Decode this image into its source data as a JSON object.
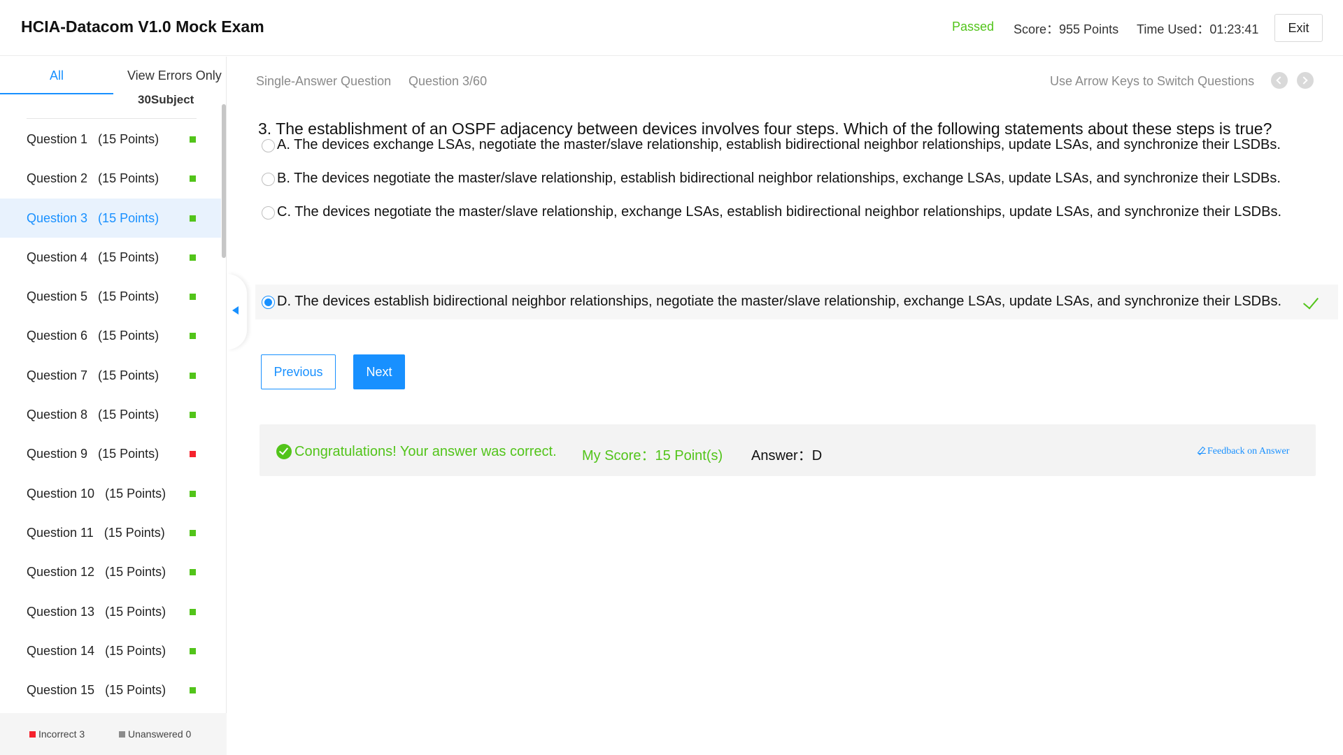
{
  "header": {
    "title": "HCIA-Datacom V1.0 Mock Exam",
    "status": "Passed",
    "score": "Score：955 Points",
    "time_used": "Time Used：01:23:41",
    "exit_label": "Exit",
    "status_color": "#52c41a"
  },
  "sidebar": {
    "tabs": {
      "all": "All",
      "errors_only": "View Errors Only"
    },
    "subject_count": "30Subject",
    "questions": [
      {
        "label": "Question 1   (15 Points)",
        "status": "correct"
      },
      {
        "label": "Question 2   (15 Points)",
        "status": "correct"
      },
      {
        "label": "Question 3   (15 Points)",
        "status": "correct",
        "active": true
      },
      {
        "label": "Question 4   (15 Points)",
        "status": "correct"
      },
      {
        "label": "Question 5   (15 Points)",
        "status": "correct"
      },
      {
        "label": "Question 6   (15 Points)",
        "status": "correct"
      },
      {
        "label": "Question 7   (15 Points)",
        "status": "correct"
      },
      {
        "label": "Question 8   (15 Points)",
        "status": "correct"
      },
      {
        "label": "Question 9   (15 Points)",
        "status": "incorrect"
      },
      {
        "label": "Question 10   (15 Points)",
        "status": "correct"
      },
      {
        "label": "Question 11   (15 Points)",
        "status": "correct"
      },
      {
        "label": "Question 12   (15 Points)",
        "status": "correct"
      },
      {
        "label": "Question 13   (15 Points)",
        "status": "correct"
      },
      {
        "label": "Question 14   (15 Points)",
        "status": "correct"
      },
      {
        "label": "Question 15   (15 Points)",
        "status": "correct"
      }
    ],
    "legend": {
      "incorrect": "Incorrect 3",
      "unanswered": "Unanswered 0"
    },
    "colors": {
      "correct": "#52c41a",
      "incorrect": "#f5222d",
      "unanswered": "#8c8c8c"
    }
  },
  "main": {
    "question_type": "Single-Answer Question",
    "question_number": "Question 3/60",
    "nav_hint": "Use Arrow Keys to Switch Questions",
    "question_text": "3. The establishment of an OSPF adjacency between devices involves four steps. Which of the following statements about these steps is true?",
    "options": [
      {
        "text": "A. The devices exchange LSAs, negotiate the master/slave relationship, establish bidirectional neighbor relationships, update LSAs, and synchronize their LSDBs.",
        "selected": false
      },
      {
        "text": "B. The devices negotiate the master/slave relationship, establish bidirectional neighbor relationships, exchange LSAs, update LSAs, and synchronize their LSDBs.",
        "selected": false
      },
      {
        "text": "C. The devices negotiate the master/slave relationship, exchange LSAs, establish bidirectional neighbor relationships, update LSAs, and synchronize their LSDBs.",
        "selected": false
      },
      {
        "text": "D. The devices establish bidirectional neighbor relationships, negotiate the master/slave relationship, exchange LSAs, update LSAs, and synchronize their LSDBs.",
        "selected": true
      }
    ],
    "previous_label": "Previous",
    "next_label": "Next",
    "result": {
      "message": "Congratulations! Your answer was correct.",
      "my_score": "My Score：15 Point(s)",
      "answer": "Answer：D",
      "feedback": "Feedback on Answer"
    },
    "accent_color": "#1890ff"
  }
}
